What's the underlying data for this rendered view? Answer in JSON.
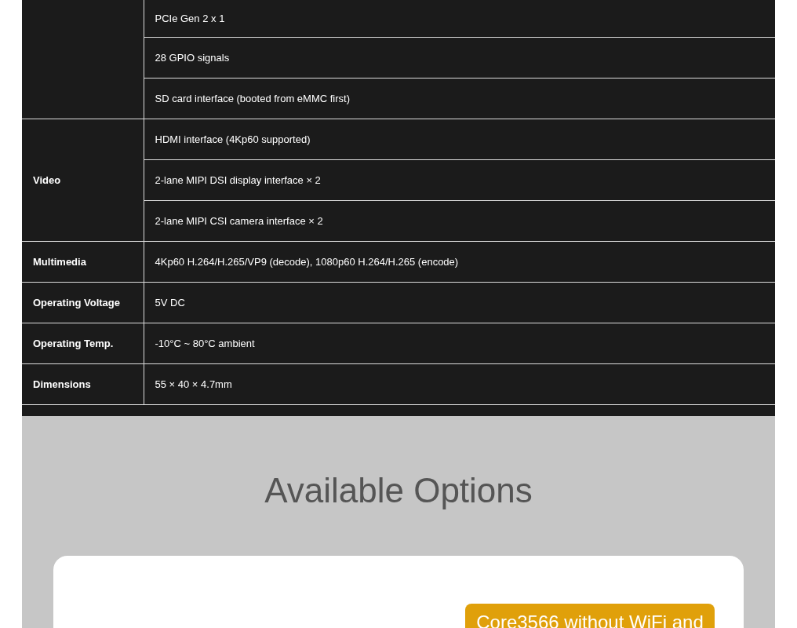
{
  "spec_table": {
    "groups": [
      {
        "values": [
          "PCIe Gen 2 x 1",
          "28 GPIO signals",
          "SD card interface (booted from eMMC first)"
        ]
      },
      {
        "label": "Video",
        "values": [
          "HDMI interface (4Kp60 supported)",
          "2-lane MIPI DSI display interface × 2",
          "2-lane MIPI CSI camera interface × 2"
        ]
      },
      {
        "label": "Multimedia",
        "values": [
          "4Kp60 H.264/H.265/VP9 (decode), 1080p60 H.264/H.265 (encode)"
        ]
      },
      {
        "label": "Operating Voltage",
        "values": [
          "5V DC"
        ]
      },
      {
        "label": "Operating Temp.",
        "values": [
          "-10°C ~ 80°C ambient"
        ]
      },
      {
        "label": "Dimensions",
        "values": [
          "55 × 40 × 4.7mm"
        ]
      }
    ]
  },
  "options_section": {
    "title": "Available Options",
    "badge": "Core3566 without WiFi and"
  }
}
